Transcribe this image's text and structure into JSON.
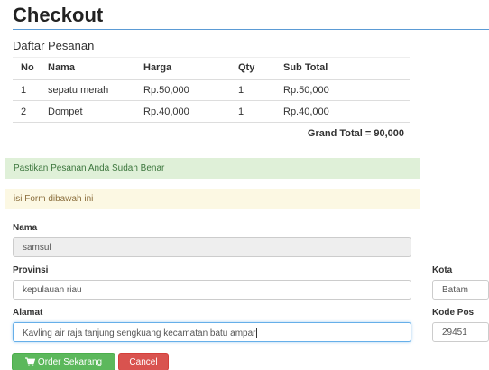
{
  "page": {
    "title": "Checkout"
  },
  "order": {
    "section_title": "Daftar Pesanan",
    "columns": [
      "No",
      "Nama",
      "Harga",
      "Qty",
      "Sub Total"
    ],
    "rows": [
      {
        "no": "1",
        "nama": "sepatu merah",
        "harga": "Rp.50,000",
        "qty": "1",
        "subtotal": "Rp.50,000"
      },
      {
        "no": "2",
        "nama": "Dompet",
        "harga": "Rp.40,000",
        "qty": "1",
        "subtotal": "Rp.40,000"
      }
    ],
    "grand_total": "Grand Total = 90,000"
  },
  "alerts": {
    "success": "Pastikan Pesanan Anda Sudah Benar",
    "warning": "isi Form dibawah ini"
  },
  "form": {
    "nama": {
      "label": "Nama",
      "value": "samsul"
    },
    "provinsi": {
      "label": "Provinsi",
      "value": "kepulauan riau"
    },
    "kota": {
      "label": "Kota",
      "value": "Batam"
    },
    "alamat": {
      "label": "Alamat",
      "value": "Kavling air raja tanjung sengkuang kecamatan batu ampar"
    },
    "kode_pos": {
      "label": "Kode Pos",
      "value": "29451"
    }
  },
  "buttons": {
    "order": "Order Sekarang",
    "cancel": "Cancel"
  },
  "icons": {
    "order_button": "shopping-cart-icon"
  },
  "colors": {
    "accent_rule": "#5b9bd5",
    "success_bg": "#dff0d8",
    "warning_bg": "#fcf8e3",
    "btn_success": "#5cb85c",
    "btn_danger": "#d9534f"
  }
}
